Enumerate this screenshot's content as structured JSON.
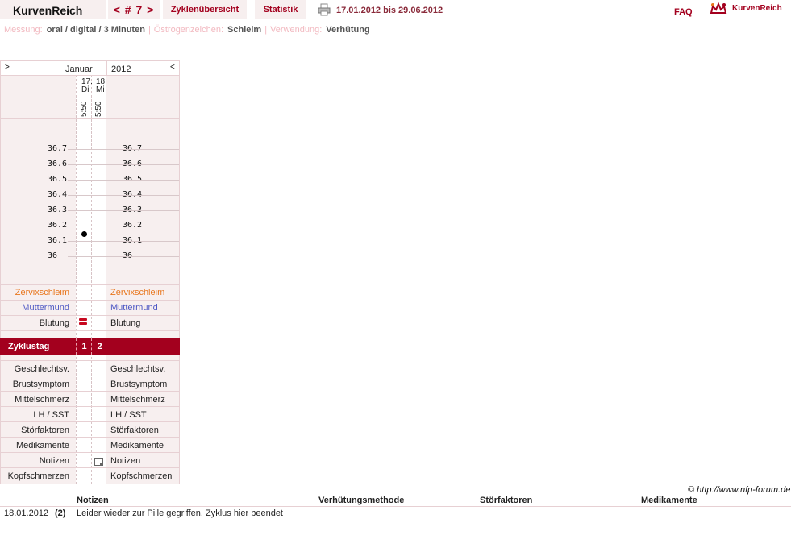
{
  "app": {
    "brand": "KurvenReich",
    "cycle_nav": "< # 7 >",
    "tab_overview": "Zyklenübersicht",
    "tab_stats": "Statistik",
    "date_range": "17.01.2012 bis 29.06.2012",
    "faq": "FAQ",
    "logo_text": "KurvenReich"
  },
  "info": {
    "measure_label": "Messung:",
    "measure_value": "oral / digital / 3 Minuten",
    "estrogen_label": "Östrogenzeichen:",
    "estrogen_value": "Schleim",
    "usage_label": "Verwendung:",
    "usage_value": "Verhütung",
    "sep": "|"
  },
  "chart": {
    "nav_right": ">",
    "nav_left": "<",
    "month": "Januar",
    "year": "2012",
    "days": [
      {
        "date": "17.",
        "weekday": "Di",
        "time": "5:50",
        "cycle_day": "1",
        "temp": 36.15,
        "bleeding": true,
        "note": false
      },
      {
        "date": "18.",
        "weekday": "Mi",
        "time": "5:50",
        "cycle_day": "2",
        "temp": null,
        "bleeding": false,
        "note": true
      }
    ],
    "temp_labels": [
      "36.7",
      "36.6",
      "36.5",
      "36.4",
      "36.3",
      "36.2",
      "36.1",
      "36"
    ],
    "rows_top": {
      "cervix": "Zervixschleim",
      "mouth": "Muttermund",
      "bleeding": "Blutung"
    },
    "cycle_day_label": "Zyklustag",
    "rows_bottom": [
      "Geschlechtsv.",
      "Brustsymptom",
      "Mittelschmerz",
      "LH / SST",
      "Störfaktoren",
      "Medikamente",
      "Notizen",
      "Kopfschmerzen"
    ]
  },
  "footer": {
    "copyright": "© http://www.nfp-forum.de",
    "headers": {
      "notes": "Notizen",
      "method": "Verhütungsmethode",
      "disruptors": "Störfaktoren",
      "meds": "Medikamente"
    },
    "rows": [
      {
        "date": "18.01.2012",
        "day": "(2)",
        "note": "Leider wieder zur Pille gegriffen. Zyklus hier beendet"
      }
    ]
  },
  "colors": {
    "accent": "#a3001e",
    "pink_bg": "#f7efef",
    "cervix": "#e8761d",
    "mouth": "#4e58c4",
    "bleeding": "#c7081f"
  }
}
